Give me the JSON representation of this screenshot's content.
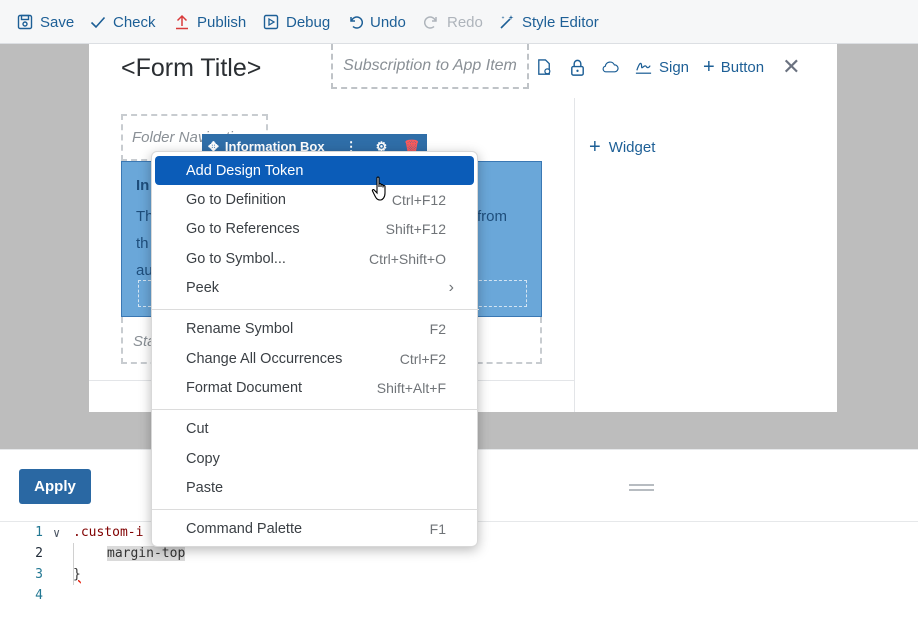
{
  "toolbar": {
    "save": "Save",
    "check": "Check",
    "publish": "Publish",
    "debug": "Debug",
    "undo": "Undo",
    "redo": "Redo",
    "style_editor": "Style Editor",
    "icons": [
      "save-icon",
      "check-icon",
      "publish-icon",
      "debug-icon",
      "undo-icon",
      "redo-icon",
      "magic-wand-icon"
    ]
  },
  "form": {
    "title": "<Form Title>",
    "subscription_placeholder": "Subscription to App Item",
    "sign": "Sign",
    "button": "Button",
    "widget": "Widget",
    "folder_navigation": "Folder Navigation",
    "info_box_label": "Information Box",
    "info_title": "In",
    "info_text": "Th from th au",
    "info_text_lines": [
      "Th",
      "th",
      "au"
    ],
    "info_text_right": "from",
    "status_label": "Sta"
  },
  "editor": {
    "apply": "Apply",
    "lines": [
      {
        "num": "1",
        "text": ".custom-i"
      },
      {
        "num": "2",
        "text": "margin-top"
      },
      {
        "num": "3",
        "text": "}"
      },
      {
        "num": "4",
        "text": ""
      }
    ]
  },
  "context_menu": {
    "items": [
      {
        "label": "Add Design Token",
        "shortcut": ""
      },
      {
        "label": "Go to Definition",
        "shortcut": "Ctrl+F12"
      },
      {
        "label": "Go to References",
        "shortcut": "Shift+F12"
      },
      {
        "label": "Go to Symbol...",
        "shortcut": "Ctrl+Shift+O"
      },
      {
        "label": "Peek",
        "shortcut": ""
      },
      {
        "label": "Rename Symbol",
        "shortcut": "F2"
      },
      {
        "label": "Change All Occurrences",
        "shortcut": "Ctrl+F2"
      },
      {
        "label": "Format Document",
        "shortcut": "Shift+Alt+F"
      },
      {
        "label": "Cut",
        "shortcut": ""
      },
      {
        "label": "Copy",
        "shortcut": ""
      },
      {
        "label": "Paste",
        "shortcut": ""
      },
      {
        "label": "Command Palette",
        "shortcut": "F1"
      }
    ],
    "highlight_color": "#0b5cb8"
  },
  "colors": {
    "accent": "#1d5f96",
    "apply_button": "#2a68a3",
    "info_box": "#6aa7d9",
    "backdrop": "#bdbdbd"
  }
}
